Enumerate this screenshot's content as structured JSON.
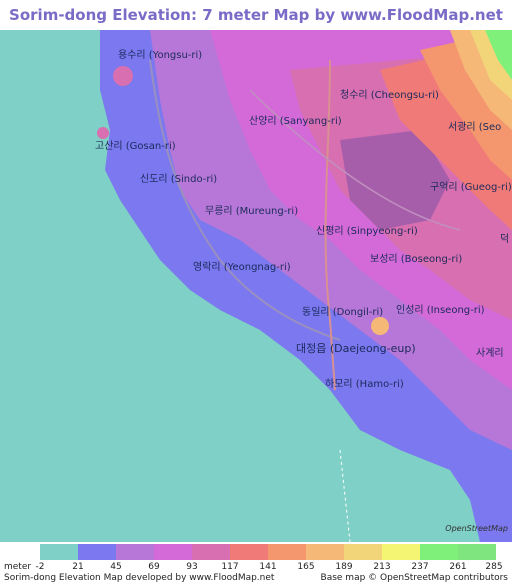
{
  "title": "Sorim-dong Elevation: 7 meter Map by www.FloodMap.net (beta)",
  "colors": {
    "sea": "#7fd0c6",
    "c0": "#7b78f0",
    "c1": "#b777d8",
    "c2": "#d46ad8",
    "c3": "#d86fb0",
    "c4": "#f07a78",
    "c5": "#f4966e",
    "c6": "#f5b877",
    "c7": "#f2d479",
    "c8": "#f5f574",
    "c9": "#7ff07a",
    "c10": "#7fe67f"
  },
  "map_labels": [
    {
      "text": "용수리 (Yongsu-ri)"
    },
    {
      "text": "고산리 (Gosan-ri)"
    },
    {
      "text": "신도리 (Sindo-ri)"
    },
    {
      "text": "무릉리 (Mureung-ri)"
    },
    {
      "text": "영락리 (Yeongnag-ri)"
    },
    {
      "text": "산양리 (Sanyang-ri)"
    },
    {
      "text": "청수리 (Cheongsu-ri)"
    },
    {
      "text": "서광리 (Seo"
    },
    {
      "text": "구억리 (Gueog-ri)"
    },
    {
      "text": "신평리 (Sinpyeong-ri)"
    },
    {
      "text": "보성리 (Boseong-ri)"
    },
    {
      "text": "동일리 (Dongil-ri)"
    },
    {
      "text": "인성리 (Inseong-ri)"
    },
    {
      "text": "대정읍 (Daejeong-eup)"
    },
    {
      "text": "하모리 (Hamo-ri)"
    },
    {
      "text": "사계리"
    },
    {
      "text": "덕"
    }
  ],
  "osm_badge": "OpenStreetMap",
  "legend": {
    "unit": "meter",
    "ticks": [
      "-2",
      "21",
      "45",
      "69",
      "93",
      "117",
      "141",
      "165",
      "189",
      "213",
      "237",
      "261",
      "285"
    ],
    "credit_left": "Sorim-dong Elevation Map developed by www.FloodMap.net",
    "credit_right": "Base map © OpenStreetMap contributors"
  }
}
